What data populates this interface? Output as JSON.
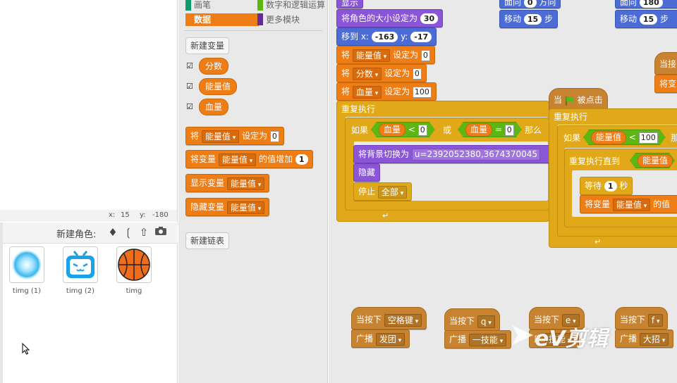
{
  "stage": {
    "coords": {
      "x_label": "x:",
      "x_value": "15",
      "y_label": "y:",
      "y_value": "-180"
    }
  },
  "sprites": {
    "new_sprite_label": "新建角色:",
    "items": [
      {
        "name": "timg (1)"
      },
      {
        "name": "timg (2)"
      },
      {
        "name": "timg"
      }
    ]
  },
  "palette": {
    "categories": {
      "pen": "画笔",
      "operators": "数字和逻辑运算",
      "data": "数据",
      "more": "更多模块"
    },
    "new_variable": "新建变量",
    "variables": [
      "分数",
      "能量值",
      "血量"
    ],
    "blocks": {
      "set": {
        "pre": "将",
        "var": "能量值",
        "mid": "设定为",
        "val": "0"
      },
      "change": {
        "pre": "将变量",
        "var": "能量值",
        "mid": "的值增加",
        "val": "1"
      },
      "show": {
        "pre": "显示变量",
        "var": "能量值"
      },
      "hide": {
        "pre": "隐藏变量",
        "var": "能量值"
      }
    },
    "new_list": "新建链表"
  },
  "scripts": {
    "s1": {
      "size": {
        "label": "将角色的大小设定为",
        "val": "30"
      },
      "goto": {
        "label": "移到 x:",
        "x": "-163",
        "ylabel": "y:",
        "y": "-17"
      },
      "set1": {
        "pre": "将",
        "var": "能量值",
        "mid": "设定为",
        "val": "0"
      },
      "set2": {
        "pre": "将",
        "var": "分数",
        "mid": "设定为",
        "val": "0"
      },
      "set3": {
        "pre": "将",
        "var": "血量",
        "mid": "设定为",
        "val": "100"
      },
      "forever": "重复执行",
      "if_label": "如果",
      "cond_a_var": "血量",
      "cond_a_op": "<",
      "cond_a_val": "0",
      "or": "或",
      "cond_b_var": "血量",
      "cond_b_op": "=",
      "cond_b_val": "0",
      "then": "那么",
      "backdrop": {
        "label": "将背景切换为",
        "val": "u=2392052380,3674370045"
      },
      "hide": "隐藏",
      "stop": {
        "label": "停止",
        "val": "全部"
      }
    },
    "s2": {
      "turn": {
        "pre": "面向",
        "val": "0",
        "post": "方向"
      },
      "move": {
        "pre": "移动",
        "val": "15",
        "post": "步"
      }
    },
    "s3": {
      "turn": {
        "pre": "面向",
        "val": "180"
      },
      "move": {
        "pre": "移动",
        "val": "15",
        "post": "步"
      }
    },
    "s4": {
      "receive": "当接",
      "set": "将变"
    },
    "s5": {
      "hat": {
        "pre": "当",
        "post": "被点击"
      },
      "forever": "重复执行",
      "if_label": "如果",
      "cond_var": "能量值",
      "cond_op": "<",
      "cond_val": "100",
      "then": "那",
      "repeat_until": "重复执行直到",
      "until_var": "能量值",
      "wait": {
        "pre": "等待",
        "val": "1",
        "post": "秒"
      },
      "change": {
        "pre": "将变量",
        "var": "能量值",
        "post": "的值"
      }
    },
    "keys": [
      {
        "hat": "当按下",
        "key": "空格键",
        "pre": "广播",
        "msg": "发团"
      },
      {
        "hat": "当按下",
        "key": "q",
        "pre": "广播",
        "msg": "一技能"
      },
      {
        "hat": "当按下",
        "key": "e",
        "pre": "广",
        "msg": "技能"
      },
      {
        "hat": "当按下",
        "key": "f",
        "pre": "广播",
        "msg": "大招"
      }
    ],
    "top_partial": "显示"
  },
  "watermark": "eV剪辑",
  "colors": {
    "data": "#ee7d16",
    "looks": "#8a55d7",
    "motion": "#4a6cd4",
    "control": "#e1a91a",
    "events": "#c88330",
    "operators": "#5cb712"
  }
}
